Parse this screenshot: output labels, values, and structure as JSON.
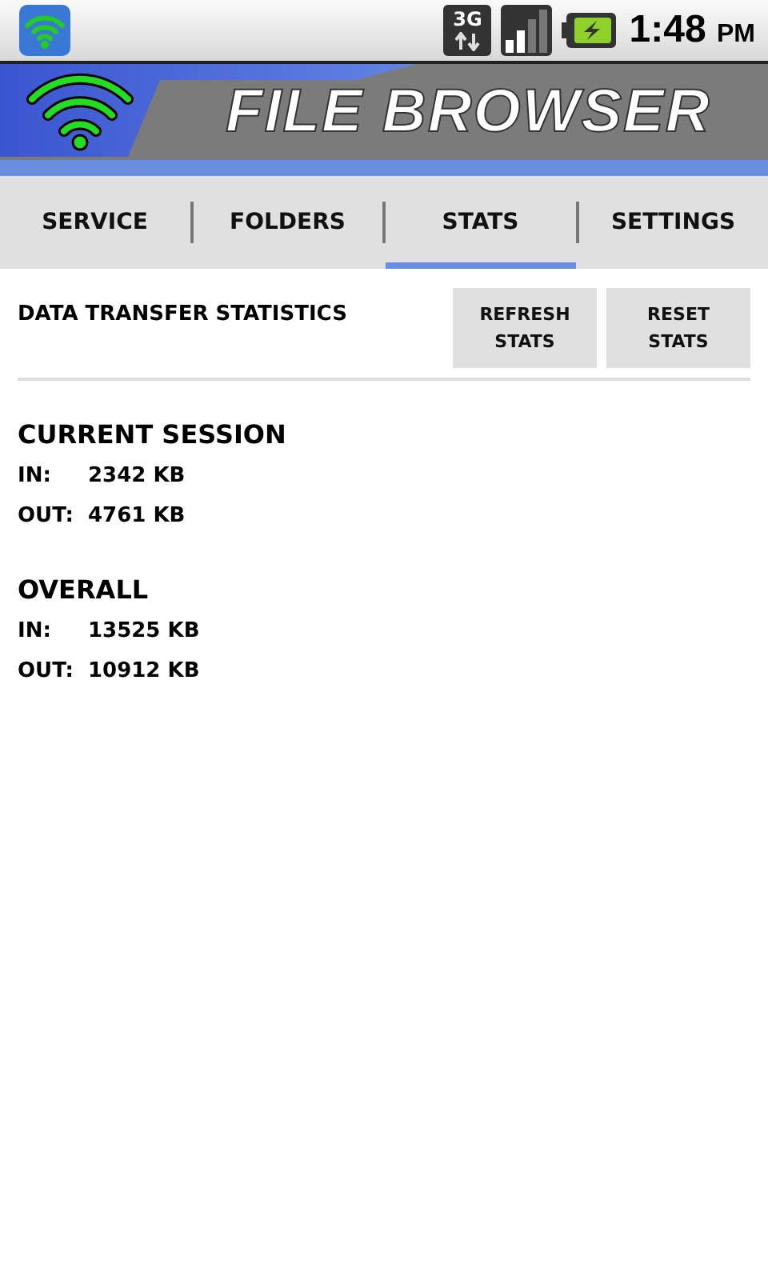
{
  "status_bar": {
    "network": "3G",
    "time": "1:48",
    "ampm": "PM"
  },
  "banner": {
    "title": "FILE BROWSER"
  },
  "tabs": [
    {
      "label": "SERVICE",
      "selected": false
    },
    {
      "label": "FOLDERS",
      "selected": false
    },
    {
      "label": "STATS",
      "selected": true
    },
    {
      "label": "SETTINGS",
      "selected": false
    }
  ],
  "header": {
    "title": "DATA TRANSFER STATISTICS",
    "buttons": [
      [
        "REFRESH",
        "STATS"
      ],
      [
        "RESET",
        "STATS"
      ]
    ]
  },
  "sections": [
    {
      "title": "CURRENT SESSION",
      "rows": [
        {
          "label": "IN:",
          "value": "2342 KB"
        },
        {
          "label": "OUT:",
          "value": "4761 KB"
        }
      ]
    },
    {
      "title": "OVERALL",
      "rows": [
        {
          "label": "IN:",
          "value": "13525 KB"
        },
        {
          "label": "OUT:",
          "value": "10912 KB"
        }
      ]
    }
  ]
}
